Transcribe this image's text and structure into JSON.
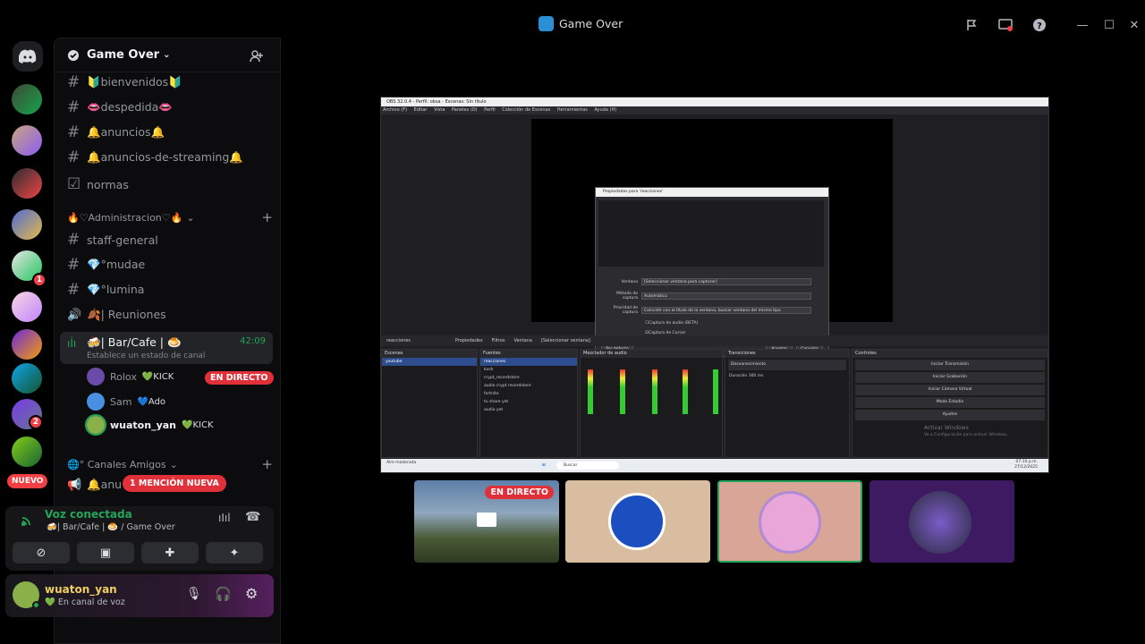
{
  "window": {
    "title": "Game Over"
  },
  "rail": {
    "nuevo_label": "NUEVO",
    "badges": [
      "1",
      "2",
      "1"
    ]
  },
  "server": {
    "name": "Game Over",
    "channels": [
      {
        "name": "🔰bienvenidos🔰",
        "type": "text"
      },
      {
        "name": "👄despedida👄",
        "type": "text"
      },
      {
        "name": "🔔anuncios🔔",
        "type": "text"
      },
      {
        "name": "🔔anuncios-de-streaming🔔",
        "type": "text"
      },
      {
        "name": "normas",
        "type": "rules"
      }
    ],
    "category_admin": "🔥♡Administracion♡🔥",
    "admin_channels": [
      {
        "name": "staff-general",
        "type": "text"
      },
      {
        "name": "💎°mudae",
        "type": "text"
      },
      {
        "name": "💎°lumina",
        "type": "text"
      },
      {
        "name": "🍂| Reuniones",
        "type": "voice"
      }
    ],
    "active_voice": {
      "name": "🍻| Bar/Cafe | 🍮",
      "timer": "42:09",
      "status_placeholder": "Establece un estado de canal"
    },
    "voice_users": [
      {
        "name": "Rolox",
        "tag": "💚KICK",
        "live": "EN DIRECTO"
      },
      {
        "name": "Sam",
        "tag": "💙Ado"
      },
      {
        "name": "wuaton_yan",
        "tag": "💚KICK"
      }
    ],
    "category_friends": "🌐° Canales Amigos",
    "friend_channel": "🔔anu",
    "mention_pill": "1 MENCIÓN NUEVA"
  },
  "voice_connected": {
    "title": "Voz conectada",
    "location": "🍻| Bar/Cafe | 🍮 / Game Over"
  },
  "user": {
    "name": "wuaton_yan",
    "status": "💚 En canal de voz"
  },
  "obs": {
    "title": "OBS 32.0.4 - Perfil: obsa - Escenas: Sin título",
    "menu": [
      "Archivo (F)",
      "Editar",
      "Vista",
      "Paneles (D)",
      "Perfil",
      "Colección de Escenas",
      "Herramientas",
      "Ayuda (H)"
    ],
    "dialog": {
      "title": "Propiedades para 'reacciones'",
      "rows": [
        {
          "label": "Ventana",
          "value": "[Seleccionar ventana para capturar]"
        },
        {
          "label": "Método de captura",
          "value": "Automático"
        },
        {
          "label": "Prioridad de captura",
          "value": "Coincidir con el título de la ventana, buscar ventana del mismo tipo"
        }
      ],
      "checks": [
        "Captura de audio (BETA)",
        "Captura de Cursor"
      ],
      "defaults_btn": "Por defecto",
      "accept_btn": "Aceptar",
      "cancel_btn": "Cancelar"
    },
    "source_bar": {
      "source": "reacciones",
      "props": "Propiedades",
      "filters": "Filtros",
      "window": "Ventana",
      "window_value": "[Seleccionar ventana]"
    },
    "scenes": {
      "title": "Escenas",
      "items": [
        "youtube"
      ]
    },
    "sources": {
      "title": "Fuentes",
      "items": [
        "reacciones",
        "kush",
        "crypt_recordstore",
        "audio crypt recordstore",
        "fortnite",
        "tu share yet",
        "audio yet"
      ]
    },
    "mixer": {
      "title": "Mezclador de audio"
    },
    "transitions": {
      "title": "Transiciones",
      "value": "Desvanecimiento",
      "duration_label": "Duración",
      "duration": "300 ms"
    },
    "controls": {
      "title": "Controles",
      "buttons": [
        "Iniciar Transmisión",
        "Iniciar Grabación",
        "Iniciar Cámara Virtual",
        "Modo Estudio",
        "Ajustes"
      ]
    },
    "activate": {
      "title": "Activar Windows",
      "subtitle": "Ve a Configuración para activar Windows."
    },
    "taskbar": {
      "search": "Buscar",
      "weather": "Alre moderada",
      "time": "07:10 p.m.",
      "date": "27/12/2025"
    }
  },
  "thumbnails": [
    {
      "label": "EN DIRECTO"
    }
  ],
  "colors": {
    "accent_green": "#23a55a",
    "live_red": "#e0303a",
    "discord_blurple": "#5865f2"
  }
}
